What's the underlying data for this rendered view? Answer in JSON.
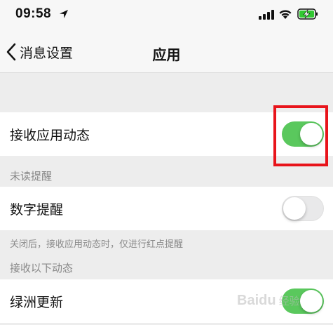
{
  "status_bar": {
    "time": "09:58",
    "icons": [
      "location-icon",
      "signal-icon",
      "wifi-icon",
      "battery-charging-icon"
    ],
    "battery_color": "#32c832"
  },
  "nav": {
    "back_label": "消息设置",
    "title": "应用"
  },
  "settings": {
    "app_updates": {
      "label": "接收应用动态",
      "enabled": true
    },
    "unread_section_header": "未读提醒",
    "number_reminder": {
      "label": "数字提醒",
      "enabled": false
    },
    "number_reminder_note": "关闭后，接收应用动态时，仅进行红点提醒",
    "receive_section_header": "接收以下动态",
    "oasis_updates": {
      "label": "绿洲更新",
      "enabled": true
    }
  },
  "watermark": {
    "brand": "Baidu",
    "sub": "经验"
  },
  "colors": {
    "toggle_on": "#5ac85d",
    "highlight": "#e8141b",
    "background": "#ededed"
  }
}
